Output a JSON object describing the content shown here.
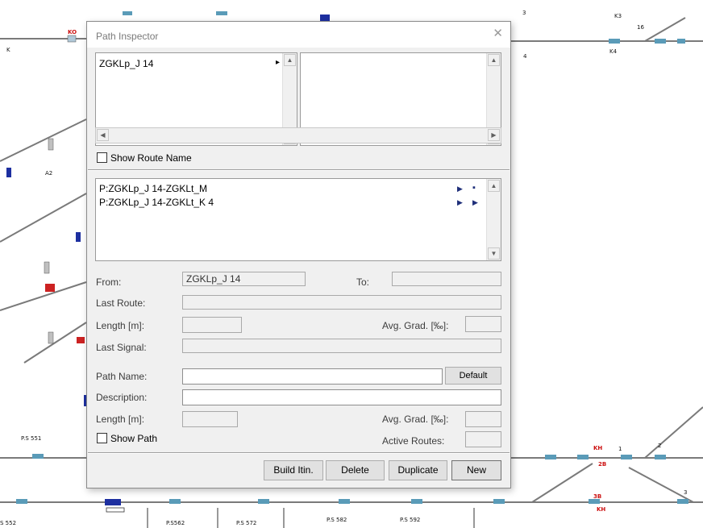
{
  "dialog": {
    "title": "Path Inspector",
    "close_glyph": "✕",
    "start_list": {
      "items": [
        {
          "label": "ZGKLp_J 14",
          "marker": "▸"
        }
      ]
    },
    "show_route_name_label": "Show Route Name",
    "paths_list": {
      "items": [
        {
          "label": "P:ZGKLp_J 14-ZGKLt_M",
          "glyphs": [
            "▶",
            "▪"
          ]
        },
        {
          "label": "P:ZGKLp_J 14-ZGKLt_K 4",
          "glyphs": [
            "▶",
            "▶"
          ]
        }
      ]
    },
    "from_label": "From:",
    "from_value": "ZGKLp_J 14",
    "to_label": "To:",
    "to_value": "",
    "last_route_label": "Last Route:",
    "last_route_value": "",
    "length_label": "Length [m]:",
    "length_value": "",
    "avg_grad_label": "Avg. Grad. [‰]:",
    "avg_grad_value": "",
    "last_signal_label": "Last Signal:",
    "last_signal_value": "",
    "path_name_label": "Path Name:",
    "path_name_value": "",
    "default_button": "Default",
    "description_label": "Description:",
    "description_value": "",
    "length2_label": "Length [m]:",
    "length2_value": "",
    "avg_grad2_label": "Avg. Grad. [‰]:",
    "avg_grad2_value": "",
    "show_path_label": "Show Path",
    "active_routes_label": "Active Routes:",
    "active_routes_value": "",
    "buttons": {
      "build_itin": "Build Itin.",
      "delete": "Delete",
      "duplicate": "Duplicate",
      "new": "New"
    }
  },
  "background": {
    "labels": {
      "top_3": "3",
      "top_k3": "K3",
      "top_16": "16",
      "top_4": "4",
      "top_k4": "K4",
      "left_a2": "A2",
      "left_k": "K",
      "ps551": "P.S 551",
      "ps562": "P.S562",
      "ps572": "P.S 572",
      "ps582": "P.S 582",
      "ps592": "P.S 592",
      "bl_552": "S 552",
      "br_1": "1",
      "br_2": "2",
      "br_3": "3",
      "red_k1": "KH",
      "red_2b": "2B",
      "red_3b": "3B",
      "red_k": "KH",
      "red_ko": "KO"
    },
    "colors": {
      "track": "#7a7a7a",
      "signal_blue": "#1d2fa0",
      "signal_red": "#cc2222",
      "block": "#5a9bb8"
    }
  }
}
